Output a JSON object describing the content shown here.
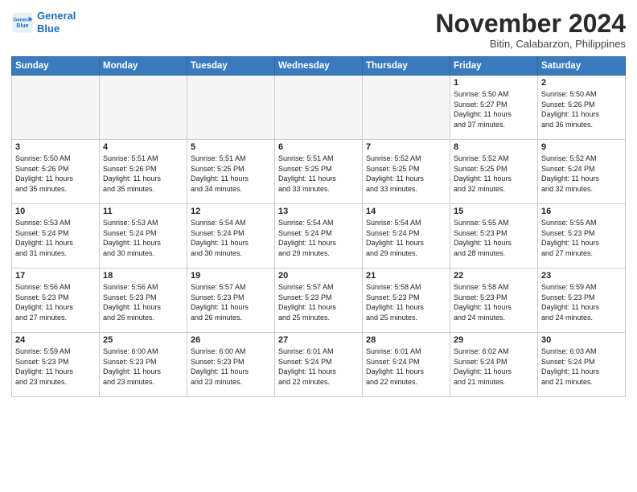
{
  "header": {
    "logo_line1": "General",
    "logo_line2": "Blue",
    "title": "November 2024",
    "subtitle": "Bitin, Calabarzon, Philippines"
  },
  "weekdays": [
    "Sunday",
    "Monday",
    "Tuesday",
    "Wednesday",
    "Thursday",
    "Friday",
    "Saturday"
  ],
  "weeks": [
    [
      {
        "day": "",
        "info": ""
      },
      {
        "day": "",
        "info": ""
      },
      {
        "day": "",
        "info": ""
      },
      {
        "day": "",
        "info": ""
      },
      {
        "day": "",
        "info": ""
      },
      {
        "day": "1",
        "info": "Sunrise: 5:50 AM\nSunset: 5:27 PM\nDaylight: 11 hours\nand 37 minutes."
      },
      {
        "day": "2",
        "info": "Sunrise: 5:50 AM\nSunset: 5:26 PM\nDaylight: 11 hours\nand 36 minutes."
      }
    ],
    [
      {
        "day": "3",
        "info": "Sunrise: 5:50 AM\nSunset: 5:26 PM\nDaylight: 11 hours\nand 35 minutes."
      },
      {
        "day": "4",
        "info": "Sunrise: 5:51 AM\nSunset: 5:26 PM\nDaylight: 11 hours\nand 35 minutes."
      },
      {
        "day": "5",
        "info": "Sunrise: 5:51 AM\nSunset: 5:25 PM\nDaylight: 11 hours\nand 34 minutes."
      },
      {
        "day": "6",
        "info": "Sunrise: 5:51 AM\nSunset: 5:25 PM\nDaylight: 11 hours\nand 33 minutes."
      },
      {
        "day": "7",
        "info": "Sunrise: 5:52 AM\nSunset: 5:25 PM\nDaylight: 11 hours\nand 33 minutes."
      },
      {
        "day": "8",
        "info": "Sunrise: 5:52 AM\nSunset: 5:25 PM\nDaylight: 11 hours\nand 32 minutes."
      },
      {
        "day": "9",
        "info": "Sunrise: 5:52 AM\nSunset: 5:24 PM\nDaylight: 11 hours\nand 32 minutes."
      }
    ],
    [
      {
        "day": "10",
        "info": "Sunrise: 5:53 AM\nSunset: 5:24 PM\nDaylight: 11 hours\nand 31 minutes."
      },
      {
        "day": "11",
        "info": "Sunrise: 5:53 AM\nSunset: 5:24 PM\nDaylight: 11 hours\nand 30 minutes."
      },
      {
        "day": "12",
        "info": "Sunrise: 5:54 AM\nSunset: 5:24 PM\nDaylight: 11 hours\nand 30 minutes."
      },
      {
        "day": "13",
        "info": "Sunrise: 5:54 AM\nSunset: 5:24 PM\nDaylight: 11 hours\nand 29 minutes."
      },
      {
        "day": "14",
        "info": "Sunrise: 5:54 AM\nSunset: 5:24 PM\nDaylight: 11 hours\nand 29 minutes."
      },
      {
        "day": "15",
        "info": "Sunrise: 5:55 AM\nSunset: 5:23 PM\nDaylight: 11 hours\nand 28 minutes."
      },
      {
        "day": "16",
        "info": "Sunrise: 5:55 AM\nSunset: 5:23 PM\nDaylight: 11 hours\nand 27 minutes."
      }
    ],
    [
      {
        "day": "17",
        "info": "Sunrise: 5:56 AM\nSunset: 5:23 PM\nDaylight: 11 hours\nand 27 minutes."
      },
      {
        "day": "18",
        "info": "Sunrise: 5:56 AM\nSunset: 5:23 PM\nDaylight: 11 hours\nand 26 minutes."
      },
      {
        "day": "19",
        "info": "Sunrise: 5:57 AM\nSunset: 5:23 PM\nDaylight: 11 hours\nand 26 minutes."
      },
      {
        "day": "20",
        "info": "Sunrise: 5:57 AM\nSunset: 5:23 PM\nDaylight: 11 hours\nand 25 minutes."
      },
      {
        "day": "21",
        "info": "Sunrise: 5:58 AM\nSunset: 5:23 PM\nDaylight: 11 hours\nand 25 minutes."
      },
      {
        "day": "22",
        "info": "Sunrise: 5:58 AM\nSunset: 5:23 PM\nDaylight: 11 hours\nand 24 minutes."
      },
      {
        "day": "23",
        "info": "Sunrise: 5:59 AM\nSunset: 5:23 PM\nDaylight: 11 hours\nand 24 minutes."
      }
    ],
    [
      {
        "day": "24",
        "info": "Sunrise: 5:59 AM\nSunset: 5:23 PM\nDaylight: 11 hours\nand 23 minutes."
      },
      {
        "day": "25",
        "info": "Sunrise: 6:00 AM\nSunset: 5:23 PM\nDaylight: 11 hours\nand 23 minutes."
      },
      {
        "day": "26",
        "info": "Sunrise: 6:00 AM\nSunset: 5:23 PM\nDaylight: 11 hours\nand 23 minutes."
      },
      {
        "day": "27",
        "info": "Sunrise: 6:01 AM\nSunset: 5:24 PM\nDaylight: 11 hours\nand 22 minutes."
      },
      {
        "day": "28",
        "info": "Sunrise: 6:01 AM\nSunset: 5:24 PM\nDaylight: 11 hours\nand 22 minutes."
      },
      {
        "day": "29",
        "info": "Sunrise: 6:02 AM\nSunset: 5:24 PM\nDaylight: 11 hours\nand 21 minutes."
      },
      {
        "day": "30",
        "info": "Sunrise: 6:03 AM\nSunset: 5:24 PM\nDaylight: 11 hours\nand 21 minutes."
      }
    ]
  ]
}
